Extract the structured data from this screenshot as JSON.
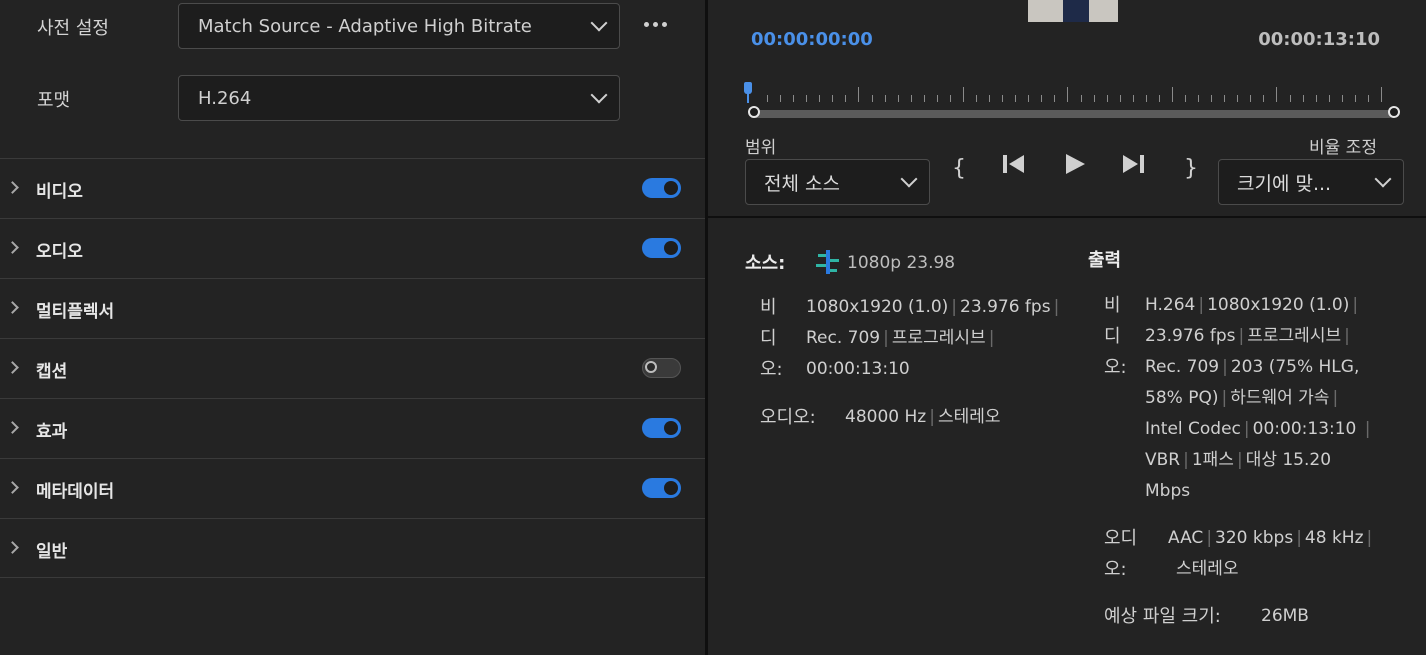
{
  "settings": {
    "preset_label": "사전 설정",
    "preset_value": "Match Source - Adaptive High Bitrate",
    "format_label": "포맷",
    "format_value": "H.264"
  },
  "sections": [
    {
      "label": "비디오",
      "toggle": "on"
    },
    {
      "label": "오디오",
      "toggle": "on"
    },
    {
      "label": "멀티플렉서",
      "toggle": "none"
    },
    {
      "label": "캡션",
      "toggle": "off"
    },
    {
      "label": "효과",
      "toggle": "on"
    },
    {
      "label": "메타데이터",
      "toggle": "on"
    },
    {
      "label": "일반",
      "toggle": "none"
    }
  ],
  "preview": {
    "timecode_start": "00:00:00:00",
    "timecode_end": "00:00:13:10",
    "range_label": "범위",
    "range_value": "전체 소스",
    "scale_label": "비율 조정",
    "scale_value": "크기에 맞..."
  },
  "source": {
    "title": "소스:",
    "summary": "1080p 23.98",
    "video_label": [
      "비",
      "디",
      "오:"
    ],
    "video_lines": [
      [
        "1080x1920 (1.0)",
        "23.976 fps",
        ""
      ],
      [
        "Rec. 709",
        "프로그레시브",
        ""
      ],
      [
        "00:00:13:10"
      ]
    ],
    "audio_label": "오디오:",
    "audio_line": [
      "48000 Hz",
      "스테레오"
    ]
  },
  "output": {
    "title": "출력",
    "video_label": [
      "비",
      "디",
      "오:"
    ],
    "video_lines": [
      [
        "H.264",
        "1080x1920 (1.0)",
        ""
      ],
      [
        "23.976 fps",
        "프로그레시브",
        ""
      ],
      [
        " Rec. 709",
        "203 (75% HLG,"
      ],
      [
        "58% PQ)",
        "하드웨어 가속",
        ""
      ],
      [
        " Intel Codec",
        "00:00:13:10 ",
        ""
      ],
      [
        "VBR",
        "1패스",
        "대상 15.20"
      ],
      [
        "Mbps"
      ]
    ],
    "audio_label": [
      "오디",
      "오:"
    ],
    "audio_lines": [
      [
        "AAC",
        "320 kbps",
        "48 kHz",
        ""
      ],
      [
        "스테레오"
      ]
    ],
    "filesize_label": "예상 파일 크기:",
    "filesize_value": "26MB"
  },
  "colors": {
    "accent": "#2a7ae0",
    "timecode": "#4a90e8",
    "background": "#232323"
  },
  "icons": [
    "more-icon",
    "chevron-down-icon",
    "chevron-right-icon",
    "mark-in-icon",
    "step-back-icon",
    "play-icon",
    "step-forward-icon",
    "mark-out-icon",
    "source-info-icon"
  ]
}
